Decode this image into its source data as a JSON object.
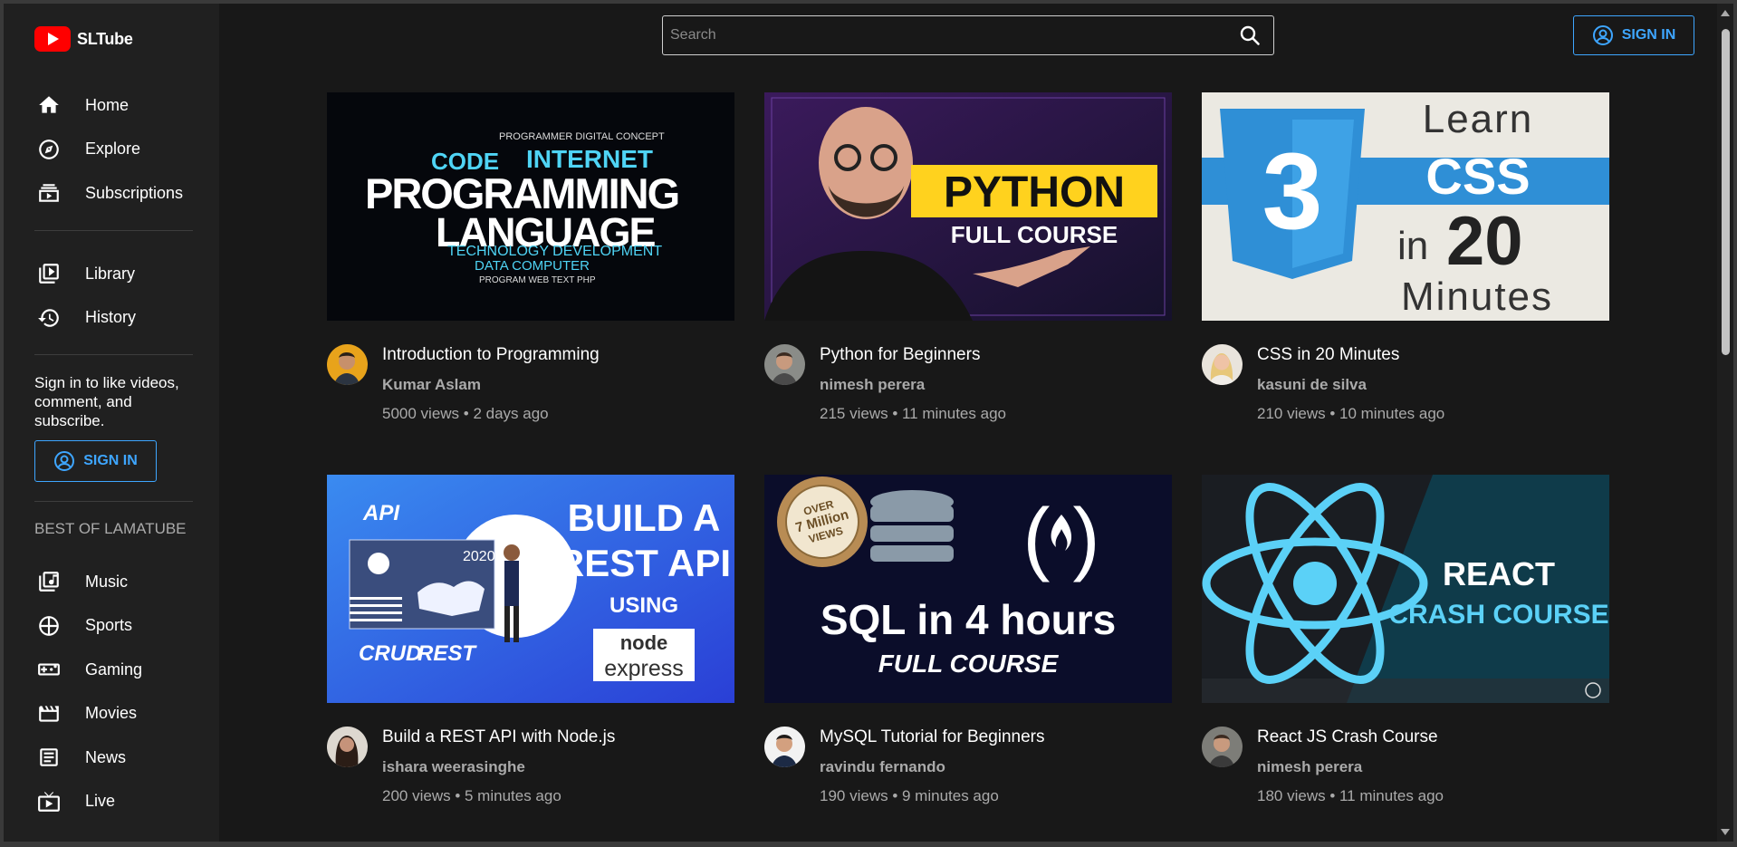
{
  "app": {
    "name": "SLTube"
  },
  "search": {
    "placeholder": "Search"
  },
  "header": {
    "signin_label": "SIGN IN"
  },
  "sidebar": {
    "nav_top": [
      {
        "label": "Home",
        "icon": "home-icon"
      },
      {
        "label": "Explore",
        "icon": "compass-icon"
      },
      {
        "label": "Subscriptions",
        "icon": "subscriptions-icon"
      }
    ],
    "nav_mid": [
      {
        "label": "Library",
        "icon": "library-icon"
      },
      {
        "label": "History",
        "icon": "history-icon"
      }
    ],
    "signin_note": "Sign in to like videos, comment, and subscribe.",
    "signin_label": "SIGN IN",
    "section_title": "BEST OF LAMATUBE",
    "nav_best": [
      {
        "label": "Music",
        "icon": "music-icon"
      },
      {
        "label": "Sports",
        "icon": "sports-icon"
      },
      {
        "label": "Gaming",
        "icon": "gaming-icon"
      },
      {
        "label": "Movies",
        "icon": "movies-icon"
      },
      {
        "label": "News",
        "icon": "news-icon"
      },
      {
        "label": "Live",
        "icon": "live-icon"
      }
    ]
  },
  "videos": [
    {
      "title": "Introduction to Programming",
      "channel": "Kumar Aslam",
      "info": "5000 views • 2 days ago",
      "thumb": {
        "words_top": "PROGRAMMER   DIGITAL CONCEPT",
        "word_a": "CODE",
        "word_b": "INTERNET",
        "word_c": "PROGRAMMING",
        "word_d": "LANGUAGE",
        "word_e": "TECHNOLOGY DEVELOPMENT",
        "word_f": "DATA  COMPUTER",
        "word_g": "PROGRAM WEB   TEXT PHP"
      }
    },
    {
      "title": "Python for Beginners",
      "channel": "nimesh perera",
      "info": "215 views • 11 minutes ago",
      "thumb": {
        "big": "PYTHON",
        "small": "FULL COURSE"
      }
    },
    {
      "title": "CSS in 20 Minutes",
      "channel": "kasuni de silva",
      "info": "210 views • 10 minutes ago",
      "thumb": {
        "l1": "Learn",
        "l2": "CSS",
        "l3a": "in",
        "l3b": "20",
        "l4": "Minutes",
        "shield_num": "3"
      }
    },
    {
      "title": "Build a REST API with Node.js",
      "channel": "ishara weerasinghe",
      "info": "200 views • 5 minutes ago",
      "thumb": {
        "api": "API",
        "year": "2020",
        "crud": "CRUD",
        "rest": "REST",
        "h1": "BUILD A",
        "h2": "REST API",
        "h3": "USING",
        "node": "node",
        "express": "express"
      }
    },
    {
      "title": "MySQL Tutorial for Beginners",
      "channel": "ravindu fernando",
      "info": "190 views • 9 minutes ago",
      "thumb": {
        "badge1": "OVER",
        "badge2": "7 Million",
        "badge3": "VIEWS",
        "big": "SQL in 4 hours",
        "small": "FULL COURSE"
      }
    },
    {
      "title": "React JS Crash Course",
      "channel": "nimesh perera",
      "info": "180 views • 11 minutes ago",
      "thumb": {
        "l1": "REACT",
        "l2": "CRASH COURSE"
      }
    }
  ],
  "colors": {
    "accent": "#3ea6ff",
    "brand": "#ff0000",
    "background": "#181818",
    "sidebar": "#202020"
  }
}
